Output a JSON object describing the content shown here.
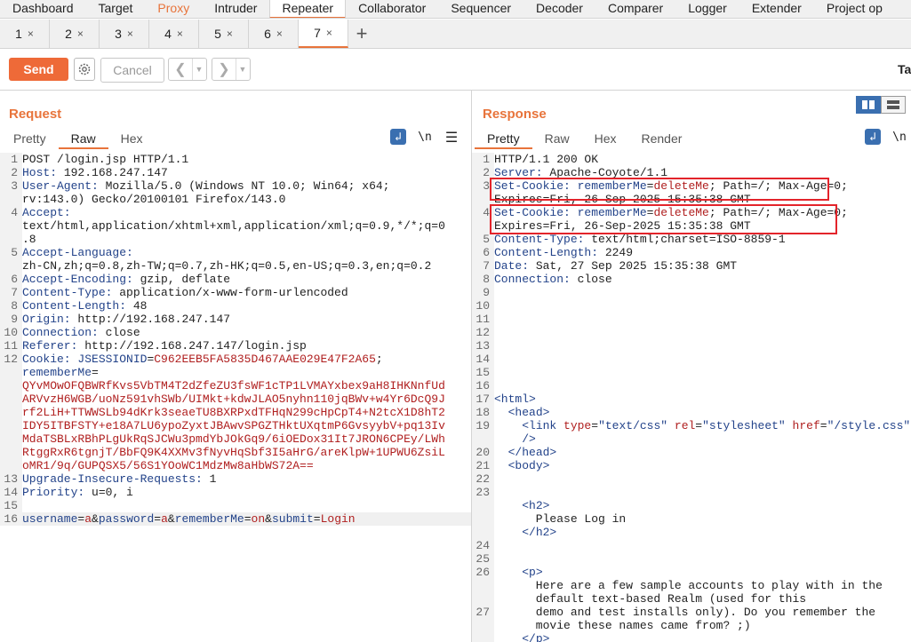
{
  "topnav": {
    "items": [
      "Dashboard",
      "Target",
      "Proxy",
      "Intruder",
      "Repeater",
      "Collaborator",
      "Sequencer",
      "Decoder",
      "Comparer",
      "Logger",
      "Extender",
      "Project op"
    ]
  },
  "subtabs": {
    "items": [
      "1",
      "2",
      "3",
      "4",
      "5",
      "6",
      "7"
    ],
    "close_glyph": "×",
    "add_glyph": "+"
  },
  "toolbar": {
    "send_label": "Send",
    "cancel_label": "Cancel",
    "target_label": "Ta"
  },
  "request": {
    "title": "Request",
    "tabs": [
      "Pretty",
      "Raw",
      "Hex"
    ],
    "newline_label": "\\n",
    "lines": [
      {
        "n": "1",
        "parts": [
          [
            "v",
            "POST /login.jsp HTTP/1.1"
          ]
        ]
      },
      {
        "n": "2",
        "parts": [
          [
            "k",
            "Host: "
          ],
          [
            "v",
            "192.168.247.147"
          ]
        ]
      },
      {
        "n": "3",
        "parts": [
          [
            "k",
            "User-Agent: "
          ],
          [
            "v",
            "Mozilla/5.0 (Windows NT 10.0; Win64; x64;"
          ]
        ]
      },
      {
        "n": "",
        "parts": [
          [
            "v",
            "rv:143.0) Gecko/20100101 Firefox/143.0"
          ]
        ]
      },
      {
        "n": "4",
        "parts": [
          [
            "k",
            "Accept:"
          ]
        ]
      },
      {
        "n": "",
        "parts": [
          [
            "v",
            "text/html,application/xhtml+xml,application/xml;q=0.9,*/*;q=0"
          ]
        ]
      },
      {
        "n": "",
        "parts": [
          [
            "v",
            ".8"
          ]
        ]
      },
      {
        "n": "5",
        "parts": [
          [
            "k",
            "Accept-Language:"
          ]
        ]
      },
      {
        "n": "",
        "parts": [
          [
            "v",
            "zh-CN,zh;q=0.8,zh-TW;q=0.7,zh-HK;q=0.5,en-US;q=0.3,en;q=0.2"
          ]
        ]
      },
      {
        "n": "6",
        "parts": [
          [
            "k",
            "Accept-Encoding: "
          ],
          [
            "v",
            "gzip, deflate"
          ]
        ]
      },
      {
        "n": "7",
        "parts": [
          [
            "k",
            "Content-Type: "
          ],
          [
            "v",
            "application/x-www-form-urlencoded"
          ]
        ]
      },
      {
        "n": "8",
        "parts": [
          [
            "k",
            "Content-Length: "
          ],
          [
            "v",
            "48"
          ]
        ]
      },
      {
        "n": "9",
        "parts": [
          [
            "k",
            "Origin: "
          ],
          [
            "v",
            "http://192.168.247.147"
          ]
        ]
      },
      {
        "n": "10",
        "parts": [
          [
            "k",
            "Connection: "
          ],
          [
            "v",
            "close"
          ]
        ]
      },
      {
        "n": "11",
        "parts": [
          [
            "k",
            "Referer: "
          ],
          [
            "v",
            "http://192.168.247.147/login.jsp"
          ]
        ]
      },
      {
        "n": "12",
        "parts": [
          [
            "k",
            "Cookie: "
          ],
          [
            "k",
            "JSESSIONID"
          ],
          [
            "v",
            "="
          ],
          [
            "r",
            "C962EEB5FA5835D467AAE029E47F2A65"
          ],
          [
            "v",
            ";"
          ]
        ]
      },
      {
        "n": "",
        "parts": [
          [
            "k",
            "rememberMe"
          ],
          [
            "v",
            "="
          ]
        ]
      },
      {
        "n": "",
        "parts": [
          [
            "r",
            "QYvMOwOFQBWRfKvs5VbTM4T2dZfeZU3fsWF1cTP1LVMAYxbex9aH8IHKNnfUd"
          ]
        ]
      },
      {
        "n": "",
        "parts": [
          [
            "r",
            "ARVvzH6WGB/uoNz591vhSWb/UIMkt+kdwJLAO5nyhn110jqBWv+w4Yr6DcQ9J"
          ]
        ]
      },
      {
        "n": "",
        "parts": [
          [
            "r",
            "rf2LiH+TTWWSLb94dKrk3seaeTU8BXRPxdTFHqN299cHpCpT4+N2tcX1D8hT2"
          ]
        ]
      },
      {
        "n": "",
        "parts": [
          [
            "r",
            "IDY5ITBFSTY+e18A7LU6ypoZyxtJBAwvSPGZTHktUXqtmP6GvsyybV+pq13Iv"
          ]
        ]
      },
      {
        "n": "",
        "parts": [
          [
            "r",
            "MdaTSBLxRBhPLgUkRqSJCWu3pmdYbJOkGq9/6iOEDox31It7JRON6CPEy/LWh"
          ]
        ]
      },
      {
        "n": "",
        "parts": [
          [
            "r",
            "RtggRxR6tgnjT/BbFQ9K4XXMv3fNyvHqSbf3I5aHrG/areKlpW+1UPWU6ZsiL"
          ]
        ]
      },
      {
        "n": "",
        "parts": [
          [
            "r",
            "oMR1/9q/GUPQSX5/56S1YOoWC1MdzMw8aHbWS72A=="
          ]
        ]
      },
      {
        "n": "13",
        "parts": [
          [
            "k",
            "Upgrade-Insecure-Requests: "
          ],
          [
            "v",
            "1"
          ]
        ]
      },
      {
        "n": "14",
        "parts": [
          [
            "k",
            "Priority: "
          ],
          [
            "v",
            "u=0, i"
          ]
        ]
      },
      {
        "n": "15",
        "parts": []
      },
      {
        "n": "16",
        "hl": true,
        "parts": [
          [
            "k",
            "username"
          ],
          [
            "v",
            "="
          ],
          [
            "r",
            "a"
          ],
          [
            "v",
            "&"
          ],
          [
            "k",
            "password"
          ],
          [
            "v",
            "="
          ],
          [
            "r",
            "a"
          ],
          [
            "v",
            "&"
          ],
          [
            "k",
            "rememberMe"
          ],
          [
            "v",
            "="
          ],
          [
            "r",
            "on"
          ],
          [
            "v",
            "&"
          ],
          [
            "k",
            "submit"
          ],
          [
            "v",
            "="
          ],
          [
            "r",
            "Login"
          ]
        ]
      }
    ]
  },
  "response": {
    "title": "Response",
    "tabs": [
      "Pretty",
      "Raw",
      "Hex",
      "Render"
    ],
    "newline_label": "\\n",
    "lines": [
      {
        "n": "1",
        "parts": [
          [
            "v",
            "HTTP/1.1 200 OK"
          ]
        ]
      },
      {
        "n": "2",
        "parts": [
          [
            "k",
            "Server: "
          ],
          [
            "v",
            "Apache-Coyote/1.1"
          ]
        ]
      },
      {
        "n": "3",
        "parts": [
          [
            "k",
            "Set-Cookie: "
          ],
          [
            "k",
            "rememberMe"
          ],
          [
            "v",
            "="
          ],
          [
            "r",
            "deleteMe"
          ],
          [
            "v",
            "; Path=/; Max-Age=0;"
          ]
        ]
      },
      {
        "n": "",
        "parts": [
          [
            "v",
            "Expires=Fri, 26-Sep-2025 15:35:38 GMT"
          ]
        ]
      },
      {
        "n": "4",
        "parts": [
          [
            "k",
            "Set-Cookie: "
          ],
          [
            "k",
            "rememberMe"
          ],
          [
            "v",
            "="
          ],
          [
            "r",
            "deleteMe"
          ],
          [
            "v",
            "; Path=/; Max-Age=0;"
          ]
        ]
      },
      {
        "n": "",
        "parts": [
          [
            "v",
            "Expires=Fri, 26-Sep-2025 15:35:38 GMT"
          ]
        ]
      },
      {
        "n": "5",
        "parts": [
          [
            "k",
            "Content-Type: "
          ],
          [
            "v",
            "text/html;charset=ISO-8859-1"
          ]
        ]
      },
      {
        "n": "6",
        "parts": [
          [
            "k",
            "Content-Length: "
          ],
          [
            "v",
            "2249"
          ]
        ]
      },
      {
        "n": "7",
        "parts": [
          [
            "k",
            "Date: "
          ],
          [
            "v",
            "Sat, 27 Sep 2025 15:35:38 GMT"
          ]
        ]
      },
      {
        "n": "8",
        "parts": [
          [
            "k",
            "Connection: "
          ],
          [
            "v",
            "close"
          ]
        ]
      },
      {
        "n": "9",
        "parts": []
      },
      {
        "n": "10",
        "parts": []
      },
      {
        "n": "11",
        "parts": []
      },
      {
        "n": "12",
        "parts": []
      },
      {
        "n": "13",
        "parts": []
      },
      {
        "n": "14",
        "parts": []
      },
      {
        "n": "15",
        "parts": []
      },
      {
        "n": "16",
        "parts": []
      },
      {
        "n": "17",
        "parts": [
          [
            "t",
            "<html>"
          ]
        ]
      },
      {
        "n": "18",
        "parts": [
          [
            "v",
            "  "
          ],
          [
            "t",
            "<head>"
          ]
        ]
      },
      {
        "n": "19",
        "parts": [
          [
            "v",
            "    "
          ],
          [
            "t",
            "<link "
          ],
          [
            "a",
            "type"
          ],
          [
            "v",
            "="
          ],
          [
            "s",
            "\"text/css\""
          ],
          [
            "v",
            " "
          ],
          [
            "a",
            "rel"
          ],
          [
            "v",
            "="
          ],
          [
            "s",
            "\"stylesheet\""
          ],
          [
            "v",
            " "
          ],
          [
            "a",
            "href"
          ],
          [
            "v",
            "="
          ],
          [
            "s",
            "\"/style.css\""
          ]
        ]
      },
      {
        "n": "",
        "parts": [
          [
            "v",
            "    "
          ],
          [
            "t",
            "/>"
          ]
        ]
      },
      {
        "n": "20",
        "parts": [
          [
            "v",
            "  "
          ],
          [
            "t",
            "</head>"
          ]
        ]
      },
      {
        "n": "21",
        "parts": [
          [
            "v",
            "  "
          ],
          [
            "t",
            "<body>"
          ]
        ]
      },
      {
        "n": "22",
        "parts": []
      },
      {
        "n": "23",
        "parts": []
      },
      {
        "n": "",
        "parts": [
          [
            "v",
            "    "
          ],
          [
            "t",
            "<h2>"
          ]
        ]
      },
      {
        "n": "",
        "parts": [
          [
            "v",
            "      Please Log in"
          ]
        ]
      },
      {
        "n": "",
        "parts": [
          [
            "v",
            "    "
          ],
          [
            "t",
            "</h2>"
          ]
        ]
      },
      {
        "n": "24",
        "parts": []
      },
      {
        "n": "25",
        "parts": []
      },
      {
        "n": "26",
        "parts": [
          [
            "v",
            "    "
          ],
          [
            "t",
            "<p>"
          ]
        ]
      },
      {
        "n": "",
        "parts": [
          [
            "v",
            "      Here are a few sample accounts to play with in the"
          ]
        ]
      },
      {
        "n": "",
        "parts": [
          [
            "v",
            "      default text-based Realm (used for this"
          ]
        ]
      },
      {
        "n": "27",
        "parts": [
          [
            "v",
            "      demo and test installs only). Do you remember the"
          ]
        ]
      },
      {
        "n": "",
        "parts": [
          [
            "v",
            "      movie these names came from? ;)"
          ]
        ]
      },
      {
        "n": "",
        "parts": [
          [
            "v",
            "    "
          ],
          [
            "t",
            "</p>"
          ]
        ]
      },
      {
        "n": "",
        "parts": []
      },
      {
        "n": "28",
        "parts": []
      }
    ]
  }
}
